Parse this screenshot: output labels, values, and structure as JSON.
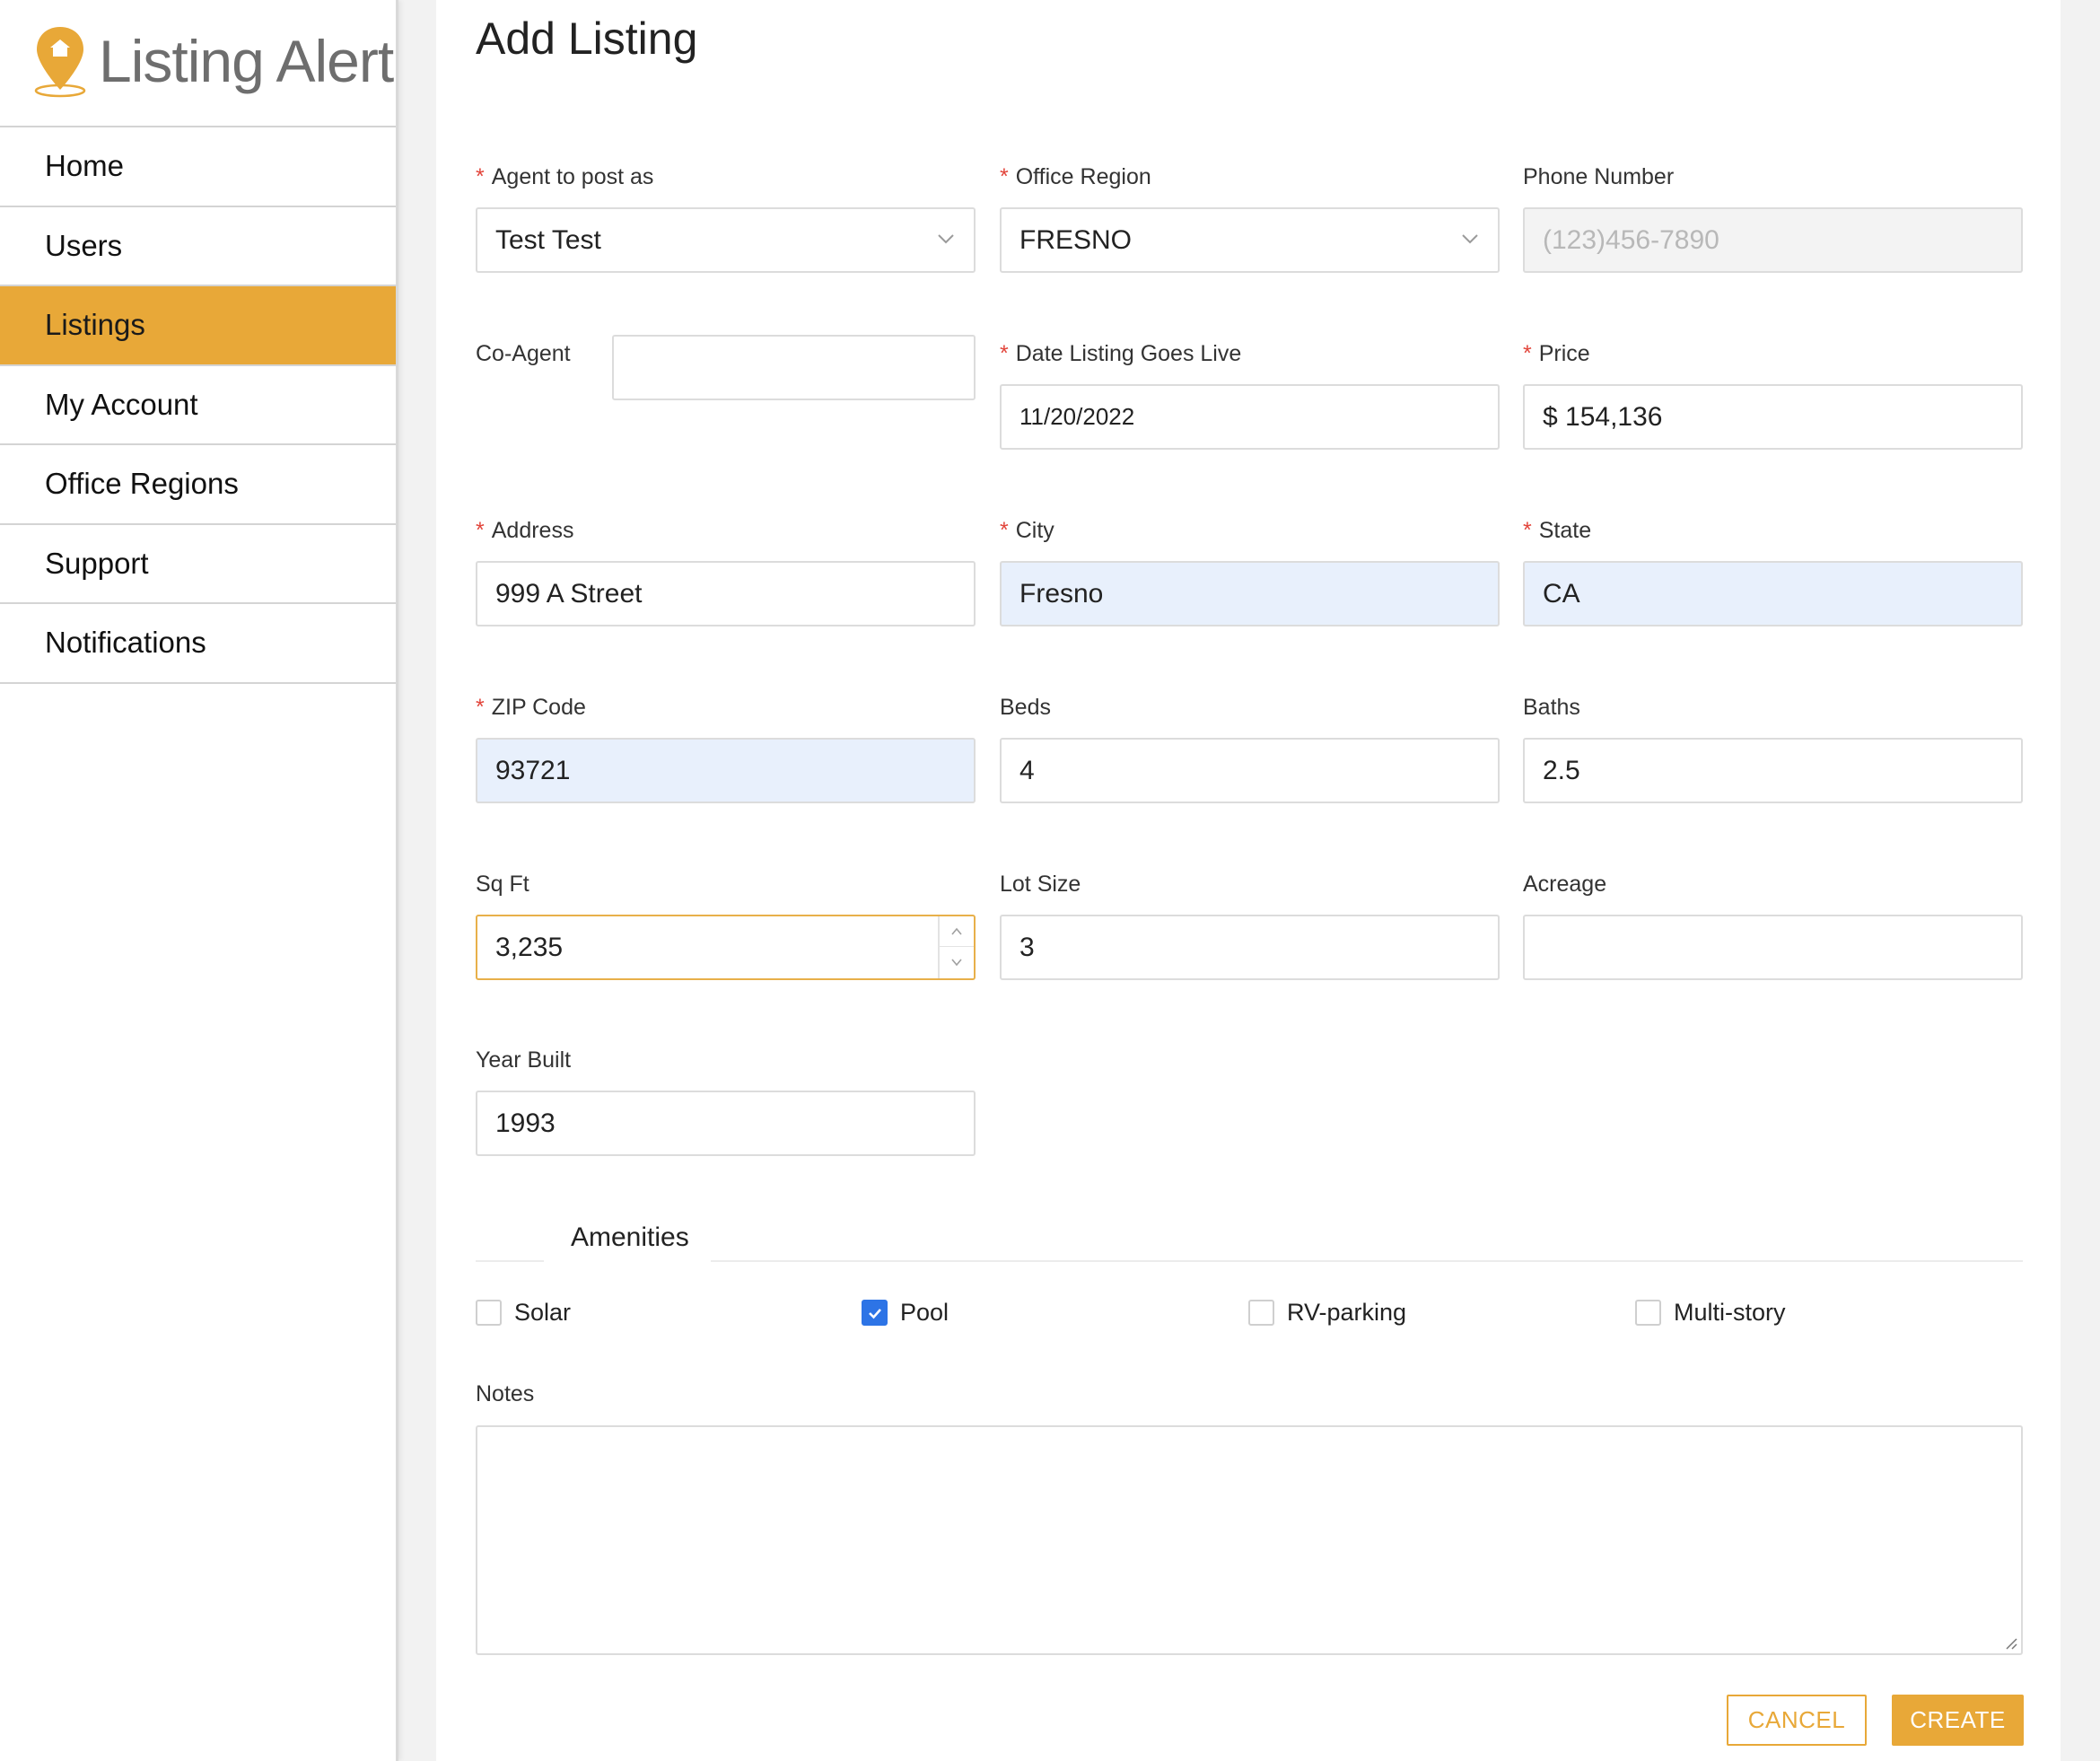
{
  "app": {
    "name": "Listing Alert",
    "brand_color": "#e8a838"
  },
  "sidebar": {
    "items": [
      {
        "label": "Home",
        "active": false
      },
      {
        "label": "Users",
        "active": false
      },
      {
        "label": "Listings",
        "active": true
      },
      {
        "label": "My Account",
        "active": false
      },
      {
        "label": "Office Regions",
        "active": false
      },
      {
        "label": "Support",
        "active": false
      },
      {
        "label": "Notifications",
        "active": false
      }
    ]
  },
  "page": {
    "title": "Add Listing"
  },
  "form": {
    "agent": {
      "label": "Agent to post as",
      "required": true,
      "value": "Test Test"
    },
    "office_region": {
      "label": "Office Region",
      "required": true,
      "value": "FRESNO"
    },
    "phone": {
      "label": "Phone Number",
      "required": false,
      "placeholder": "(123)456-7890"
    },
    "co_agent": {
      "label": "Co-Agent",
      "required": false,
      "value": ""
    },
    "date_live": {
      "label": "Date Listing Goes Live",
      "required": true,
      "value": "11/20/2022"
    },
    "price": {
      "label": "Price",
      "required": true,
      "value": "$ 154,136"
    },
    "address": {
      "label": "Address",
      "required": true,
      "value": "999 A Street"
    },
    "city": {
      "label": "City",
      "required": true,
      "value": "Fresno"
    },
    "state": {
      "label": "State",
      "required": true,
      "value": "CA"
    },
    "zip": {
      "label": "ZIP Code",
      "required": true,
      "value": "93721"
    },
    "beds": {
      "label": "Beds",
      "required": false,
      "value": "4"
    },
    "baths": {
      "label": "Baths",
      "required": false,
      "value": "2.5"
    },
    "sqft": {
      "label": "Sq Ft",
      "required": false,
      "value": "3,235"
    },
    "lot_size": {
      "label": "Lot Size",
      "required": false,
      "value": "3"
    },
    "acreage": {
      "label": "Acreage",
      "required": false,
      "value": ""
    },
    "year_built": {
      "label": "Year Built",
      "required": false,
      "value": "1993"
    },
    "required_marker": "*"
  },
  "amenities": {
    "title": "Amenities",
    "items": [
      {
        "label": "Solar",
        "checked": false
      },
      {
        "label": "Pool",
        "checked": true
      },
      {
        "label": "RV-parking",
        "checked": false
      },
      {
        "label": "Multi-story",
        "checked": false
      }
    ]
  },
  "notes": {
    "label": "Notes",
    "value": ""
  },
  "actions": {
    "cancel_label": "CANCEL",
    "create_label": "CREATE"
  }
}
